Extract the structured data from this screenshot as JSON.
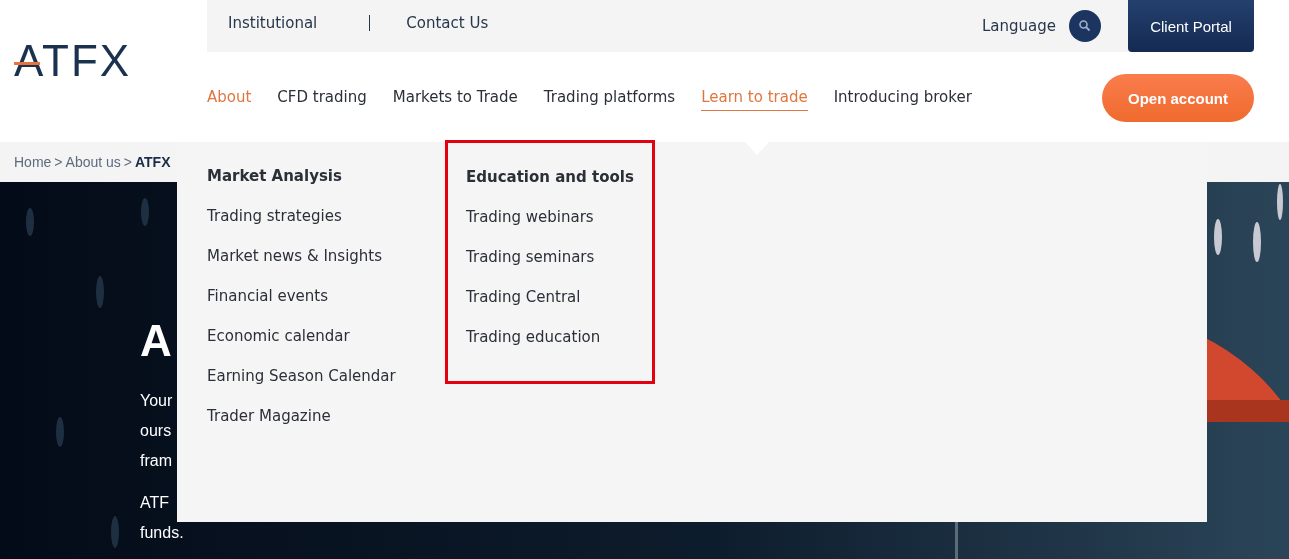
{
  "logo": {
    "text": "ATFX"
  },
  "top_bar": {
    "links": [
      "Institutional",
      "Contact Us"
    ],
    "language": "Language",
    "client_portal": "Client Portal"
  },
  "nav": {
    "items": [
      {
        "label": "About",
        "selected": false,
        "current": true
      },
      {
        "label": "CFD trading",
        "selected": false,
        "current": false
      },
      {
        "label": "Markets to Trade",
        "selected": false,
        "current": false
      },
      {
        "label": "Trading platforms",
        "selected": false,
        "current": false
      },
      {
        "label": "Learn to trade",
        "selected": true,
        "current": false
      },
      {
        "label": "Introducing broker",
        "selected": false,
        "current": false
      }
    ],
    "open_account": "Open account"
  },
  "breadcrumb": {
    "links": [
      "Home",
      "About us"
    ],
    "separator": ">",
    "current": "ATFX"
  },
  "hero": {
    "kind": "picture",
    "heading": "A",
    "paragraphs": [
      [
        "Your",
        "ours",
        "fram"
      ],
      [
        "ATF",
        "funds."
      ]
    ]
  },
  "dropdown": {
    "columns": [
      {
        "heading": "Market Analysis",
        "highlighted": false,
        "items": [
          "Trading strategies",
          "Market news & Insights",
          "Financial events",
          "Economic calendar",
          "Earning Season Calendar",
          "Trader Magazine"
        ]
      },
      {
        "heading": "Education and tools",
        "highlighted": true,
        "items": [
          "Trading webinars",
          "Trading seminars",
          "Trading Central",
          "Trading education"
        ]
      }
    ]
  }
}
